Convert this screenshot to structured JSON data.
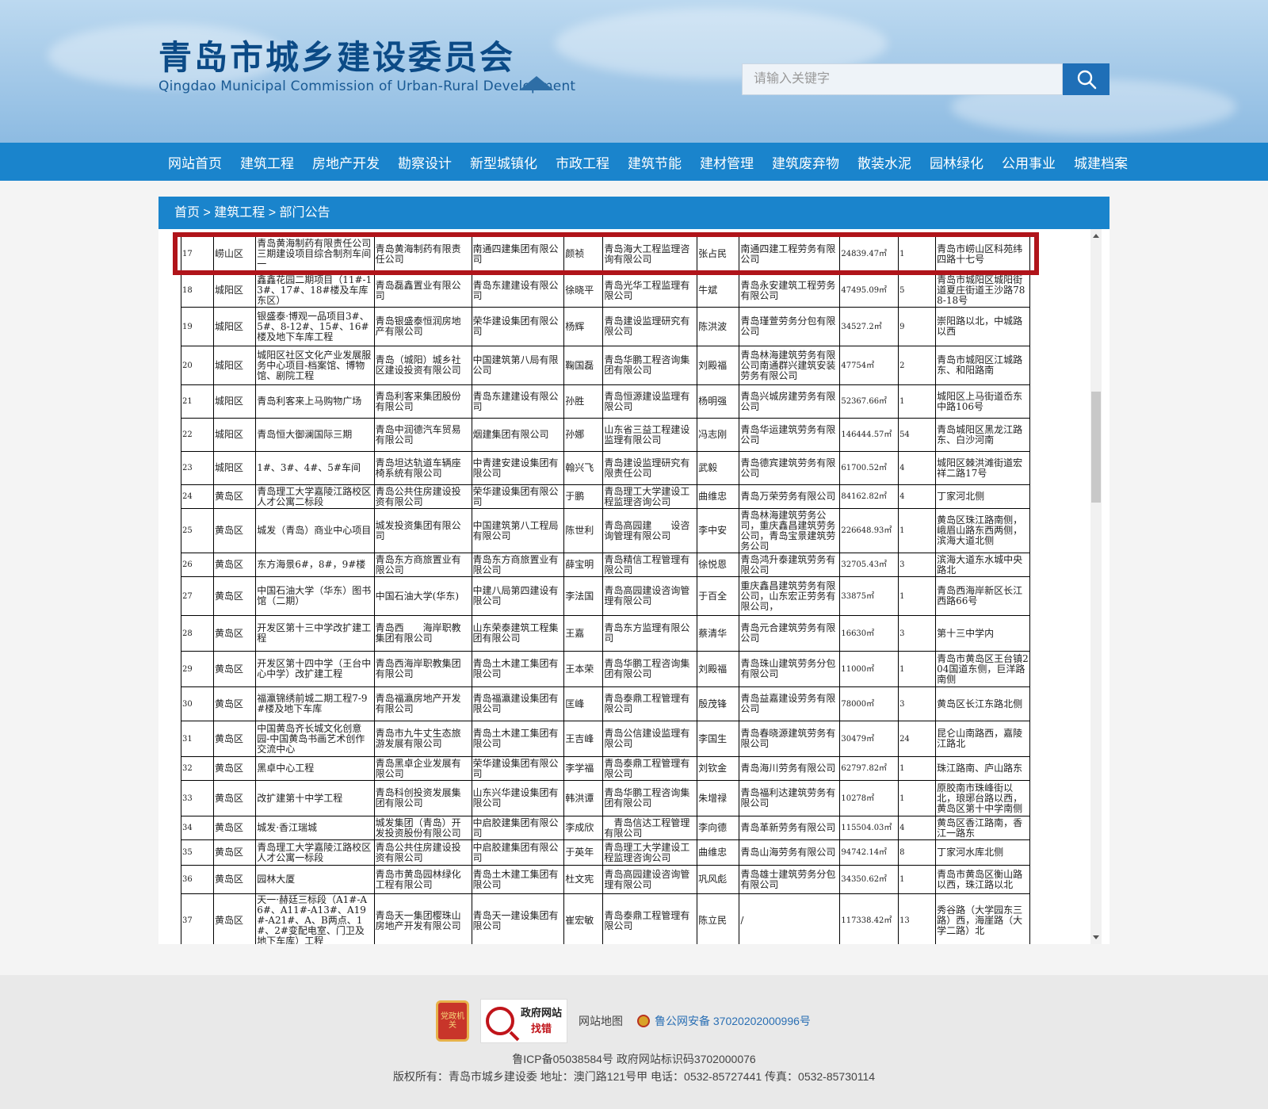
{
  "header": {
    "logo_cn": "青岛市城乡建设委员会",
    "logo_en": "Qingdao Municipal Commission of Urban-Rural Development",
    "search_placeholder": "请输入关键字"
  },
  "nav": [
    "网站首页",
    "建筑工程",
    "房地产开发",
    "勘察设计",
    "新型城镇化",
    "市政工程",
    "建筑节能",
    "建材管理",
    "建筑废弃物",
    "散装水泥",
    "园林绿化",
    "公用事业",
    "城建档案"
  ],
  "breadcrumb": {
    "home": "首页",
    "sep1": " > ",
    "section": "建筑工程",
    "sep2": " > ",
    "page": "部门公告"
  },
  "table": {
    "rows": [
      [
        "17",
        "崂山区",
        "青岛黄海制药有限责任公司三期建设项目综合制剂车间一",
        "青岛黄海制药有限责任公司",
        "南通四建集团有限公司",
        "颜祯",
        "青岛海大工程监理咨询有限公司",
        "张占民",
        "南通四建工程劳务有限公司",
        "24839.47㎡",
        "1",
        "青岛市崂山区科苑纬四路十七号"
      ],
      [
        "18",
        "城阳区",
        "鑫鑫花园二期项目（11#-13#、17#、18#楼及车库东区）",
        "青岛磊鑫置业有限公司",
        "青岛东建建设有限公司",
        "徐晓平",
        "青岛光华工程监理有限公司",
        "牛斌",
        "青岛永安建筑工程劳务有限公司",
        "47495.09㎡",
        "5",
        "青岛市城阳区城阳街道夏庄街道王沙路788-18号"
      ],
      [
        "19",
        "城阳区",
        "银盛泰·博观一品项目3#、5#、8-12#、15#、16#楼及地下车库工程",
        "青岛银盛泰恒润房地产有限公司",
        "荣华建设集团有限公司",
        "杨辉",
        "青岛建设监理研究有限公司",
        "陈洪波",
        "青岛瑾萱劳务分包有限公司",
        "34527.2㎡",
        "9",
        "崇阳路以北，中城路以西"
      ],
      [
        "20",
        "城阳区",
        "城阳区社区文化产业发展服务中心项目-档案馆、博物馆、剧院工程",
        "青岛（城阳）城乡社区建设投资有限公司",
        "中国建筑第八局有限公司",
        "鞠国磊",
        "青岛华鹏工程咨询集团有限公司",
        "刘殿福",
        "青岛林海建筑劳务有限公司南通群兴建筑安装劳务有限公司",
        "47754㎡",
        "2",
        "青岛市城阳区江城路东、和阳路南"
      ],
      [
        "21",
        "城阳区",
        "青岛利客来上马购物广场",
        "青岛利客来集团股份有限公司",
        "青岛东建建设有限公司",
        "孙胜",
        "青岛恒源建设监理有限公司",
        "杨明强",
        "青岛兴城房建劳务有限公司",
        "52367.66㎡",
        "1",
        "城阳区上马街道岙东中路106号"
      ],
      [
        "22",
        "城阳区",
        "青岛恒大御澜国际三期",
        "青岛中润德汽车贸易有限公司",
        "烟建集团有限公司",
        "孙娜",
        "山东省三益工程建设监理有限公司",
        "冯志刚",
        "青岛华运建筑劳务有限公司",
        "146444.57㎡",
        "54",
        "青岛城阳区黑龙江路东、白沙河南"
      ],
      [
        "23",
        "城阳区",
        "1#、3#、4#、5#车间",
        "青岛坦达轨道车辆座椅系统有限公司",
        "中青建安建设集团有限公司",
        "翰兴飞",
        "青岛建设监理研究有限责任公司",
        "武毅",
        "青岛德宾建筑劳务有限公司",
        "61700.52㎡",
        "4",
        "城阳区棘洪滩街道宏祥二路17号"
      ],
      [
        "24",
        "黄岛区",
        "青岛理工大学嘉陵江路校区人才公寓二标段",
        "青岛公共住房建设投资有限公司",
        "荣华建设集团有限公司",
        "于鹏",
        "青岛理工大学建设工程监理咨询公司",
        "曲维忠",
        "青岛万荣劳务有限公司",
        "84162.82㎡",
        "4",
        "丁家河北侧"
      ],
      [
        "25",
        "黄岛区",
        "城发（青岛）商业中心项目",
        "城发投资集团有限公司",
        "中国建筑第八工程局有限公司",
        "陈世利",
        "青岛高园建　　设咨询管理有限公司",
        "李中安",
        "青岛林海建筑劳务公司，重庆鑫昌建筑劳务公司，青岛宝景建筑劳务公司",
        "226648.93㎡",
        "1",
        "黄岛区珠江路南侧，峨眉山路东西两侧，滨海大道北侧"
      ],
      [
        "26",
        "黄岛区",
        "东方海景6#，8#，9#楼",
        "青岛东方商旅置业有限公司",
        "青岛东方商旅置业有限公司",
        "薛宝明",
        "青岛精信工程管理有限公司",
        "徐悦恩",
        "青岛鸿升泰建筑劳务有限公司",
        "32705.43㎡",
        "3",
        "滨海大道东水城中央路北"
      ],
      [
        "27",
        "黄岛区",
        "中国石油大学（华东）图书馆（二期）",
        "中国石油大学(华东)",
        "中建八局第四建设有限公司",
        "李法国",
        "青岛高园建设咨询管理有限公司",
        "于百全",
        "重庆鑫昌建筑劳务有限公司，山东宏正劳务有限公司，",
        "33875㎡",
        "1",
        "青岛西海岸新区长江西路66号"
      ],
      [
        "28",
        "黄岛区",
        "开发区第十三中学改扩建工程",
        "青岛西　　海岸职教集团有限公司",
        "山东荣泰建筑工程集团有限公司",
        "王嘉",
        "青岛东方监理有限公司",
        "蔡清华",
        "青岛元合建筑劳务有限公司",
        "16630㎡",
        "3",
        "第十三中学内"
      ],
      [
        "29",
        "黄岛区",
        "开发区第十四中学（王台中心中学）改扩建工程",
        "青岛西海岸职教集团有限公司",
        "青岛土木建工集团有限公司",
        "王本荣",
        "青岛华鹏工程咨询集团有限公司",
        "刘殿福",
        "青岛珠山建筑劳务分包有限公司",
        "11000㎡",
        "1",
        "青岛市黄岛区王台镇204国道东侧，巨洋路南侧"
      ],
      [
        "30",
        "黄岛区",
        "福瀛锦绣前城二期工程7-9#楼及地下车库",
        "青岛福瀛房地产开发有限公司",
        "青岛福瀛建设集团有限公司",
        "匡峰",
        "青岛泰鼎工程管理有限公司",
        "殷茂锋",
        "青岛益嘉建设劳务有限公司",
        "78000㎡",
        "3",
        "黄岛区长江东路北侧"
      ],
      [
        "31",
        "黄岛区",
        "中国黄岛齐长城文化创意园-中国黄岛书画艺术创作交流中心",
        "青岛市九牛丈生态旅游发展有限公司",
        "青岛土木建工集团有限公司",
        "王吉峰",
        "青岛公信建设监理有限公司",
        "李国生",
        "青岛春晓源建筑劳务有限公司",
        "30479㎡",
        "24",
        "昆仑山南路西，嘉陵江路北"
      ],
      [
        "32",
        "黄岛区",
        "黑卓中心工程",
        "青岛黑卓企业发展有限公司",
        "荣华建设集团有限公司",
        "李学福",
        "青岛泰鼎工程管理有限公司",
        "刘钦金",
        "青岛海川劳务有限公司",
        "62797.82㎡",
        "1",
        "珠江路南、庐山路东"
      ],
      [
        "33",
        "黄岛区",
        "改扩建第十中学工程",
        "青岛科创投资发展集团有限公司",
        "山东兴华建设集团有限公司",
        "韩洪谭",
        "青岛华鹏工程咨询集团有限公司",
        "朱增禄",
        "青岛福利达建筑劳务有限公司",
        "10278㎡",
        "1",
        "原胶南市珠峰街以北，琅琊台路以西，黄岛区第十中学南侧"
      ],
      [
        "34",
        "黄岛区",
        "城发·香江瑞城",
        "城发集团（青岛）开发投资股份有限公司",
        "中启胶建集团有限公司",
        "李成欣",
        "　青岛信达工程管理有限公司",
        "李向德",
        "青岛革新劳务有限公司",
        "115504.03㎡",
        "4",
        "黄岛区香江路南，香江一路东"
      ],
      [
        "35",
        "黄岛区",
        "青岛理工大学嘉陵江路校区人才公寓一标段",
        "青岛公共住房建设投资有限公司",
        "中启胶建集团有限公司",
        "于英年",
        "青岛理工大学建设工程监理咨询公司",
        "曲维忠",
        "青岛山海劳务有限公司",
        "94742.14㎡",
        "8",
        "丁家河水库北侧"
      ],
      [
        "36",
        "黄岛区",
        "园林大厦",
        "青岛市黄岛园林绿化工程有限公司",
        "青岛土木建工集团有限公司",
        "杜文宪",
        "青岛高园建设咨询管理有限公司",
        "巩风彪",
        "青岛雄士建筑劳务分包有限公司",
        "34350.62㎡",
        "1",
        "青岛市黄岛区衡山路以西，珠江路以北"
      ],
      [
        "37",
        "黄岛区",
        "天一·赫廷三标段（A1#-A6#、A11#-A13#、A19#-A21#、A、B两点、1#、2#变配电室、门卫及地下车库）工程",
        "青岛天一集团樱珠山房地产开发有限公司",
        "青岛天一建设集团有限公司",
        "崔宏敏",
        "青岛泰鼎工程管理有限公司",
        "陈立民",
        "/",
        "117338.42㎡",
        "13",
        "秀谷路（大学园东三路）西，海崖路（大学二路）北"
      ]
    ]
  },
  "footer": {
    "badge_text": "党政机关",
    "report_line1": "政府网站",
    "report_line2": "找错",
    "sitemap": "网站地图",
    "police": "鲁公网安备 37020202000996号",
    "icp": "鲁ICP备05038584号 政府网站标识码3702000076",
    "copyright": "版权所有：青岛市城乡建设委 地址：澳门路121号甲 电话：0532-85727441 传真：0532-85730114"
  },
  "colors": {
    "nav_bg": "#1a84cc",
    "highlight": "#b0141a",
    "search_btn": "#1f6fb7"
  }
}
